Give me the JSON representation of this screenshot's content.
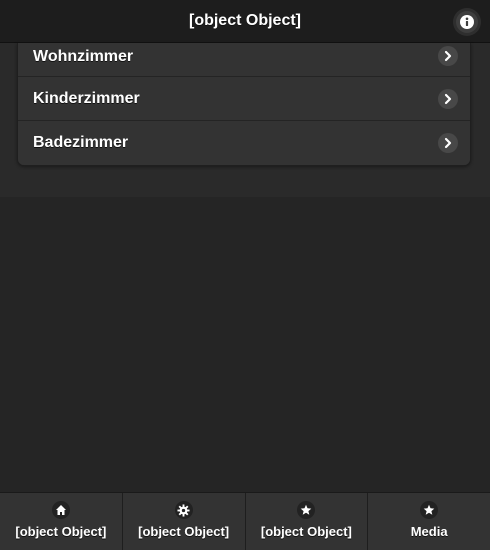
{
  "header": {
    "title": "[object Object]",
    "info_icon": "info-icon"
  },
  "rooms": {
    "items": [
      {
        "label": "Wohnzimmer",
        "icon": "chevron-right-icon"
      },
      {
        "label": "Kinderzimmer",
        "icon": "chevron-right-icon"
      },
      {
        "label": "Badezimmer",
        "icon": "chevron-right-icon"
      }
    ]
  },
  "footer": {
    "tabs": [
      {
        "label": "[object Object]",
        "icon": "home-icon"
      },
      {
        "label": "[object Object]",
        "icon": "gear-icon"
      },
      {
        "label": "[object Object]",
        "icon": "star-icon"
      },
      {
        "label": "Media",
        "icon": "star-icon"
      }
    ]
  },
  "colors": {
    "background": "#252525",
    "header": "#1d1d1d",
    "list_item": "#333333",
    "text": "#ffffff"
  }
}
